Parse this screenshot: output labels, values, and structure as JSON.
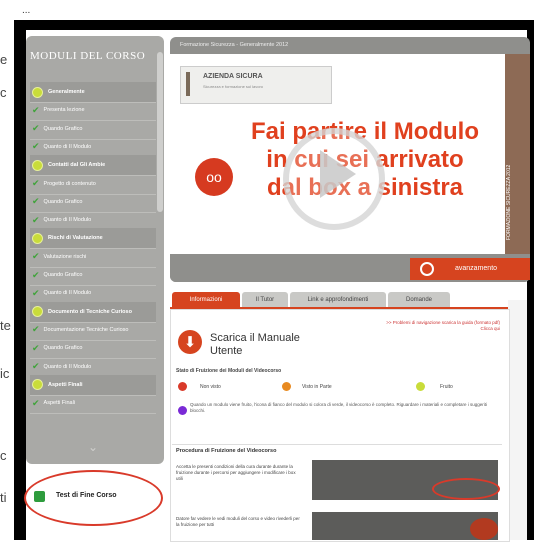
{
  "sidebar": {
    "title": "MODULI DEL CORSO",
    "rows": [
      {
        "type": "module",
        "label": "Generalmente"
      },
      {
        "type": "lesson",
        "label": "Presenta lezione"
      },
      {
        "type": "lesson",
        "label": "Quando Grafico"
      },
      {
        "type": "lesson",
        "label": "Quanto di Il Modulo"
      },
      {
        "type": "module",
        "label": "Contatti dal Gli Ambie"
      },
      {
        "type": "lesson",
        "label": "Progetto di contenuto"
      },
      {
        "type": "lesson",
        "label": "Quando Grafico"
      },
      {
        "type": "lesson",
        "label": "Quanto di Il Modulo"
      },
      {
        "type": "module",
        "label": "Rischi di Valutazione"
      },
      {
        "type": "lesson",
        "label": "Valutazione rischi"
      },
      {
        "type": "lesson",
        "label": "Quando Grafico"
      },
      {
        "type": "lesson",
        "label": "Quanto di Il Modulo"
      },
      {
        "type": "module",
        "label": "Documento di Tecniche Curioso"
      },
      {
        "type": "lesson",
        "label": "Documentazione Tecniche Curioso"
      },
      {
        "type": "lesson",
        "label": "Quando Grafico"
      },
      {
        "type": "lesson",
        "label": "Quanto di Il Modulo"
      },
      {
        "type": "module",
        "label": "Aspetti Finali"
      },
      {
        "type": "lesson",
        "label": "Aspetti Finali"
      }
    ],
    "test_label": "Test di Fine Corso"
  },
  "background": {
    "header_text": "...",
    "left_glyphs": [
      "e",
      "c",
      "te",
      "ic",
      "c",
      "ti"
    ]
  },
  "video": {
    "title": "Formazione Sicurezza - Generalmente 2012",
    "logo_title": "AZIENDA SICURA",
    "logo_sub": "Sicurezza e formazione sul lavoro",
    "headline_lines": [
      "Fai partire il Modulo",
      "in cui sei arrivato",
      "dal box a sinistra"
    ],
    "side_text": "FORMAZIONE SICUREZZA 2012",
    "badge_icon": "oo",
    "next_label": "avanzamento"
  },
  "tabs": [
    {
      "label": "Informazioni",
      "active": true
    },
    {
      "label": "Il Tutor",
      "active": false
    },
    {
      "label": "Link e approfondimenti",
      "active": false
    },
    {
      "label": "Domande",
      "active": false
    }
  ],
  "info": {
    "download_title": "Scarica il Manuale Utente",
    "download_link": ">> Problemi di navigazione scarica la guida (formato pdf) Clicca qui",
    "stato_heading": "Stato di Fruizione dei Moduli del Videocorso",
    "legend": [
      {
        "label": "Non visto",
        "color": "#d93a2a"
      },
      {
        "label": "Visto in Parte",
        "color": "#e88a20"
      },
      {
        "label": "Fruito",
        "color": "#c9dc3a"
      },
      {
        "label": "",
        "color": "#7a2ad6"
      }
    ],
    "stato_note": "Quando un modulo viene fruito, l'icona di fianco del modulo si colora di verde, il videocorso è completo. Riguardare i materiali e completare i suggeriti blocchi.",
    "section_2_heading": "Procedura di Fruizione del Videocorso",
    "para_1": "Accetta le presenti condizioni della cura durante durante la fruizione durante i percorsi per aggiungere i modificare i box utili",
    "para_2": "Datore far vedere le vedi moduli del corso e video rivederli per la fruizione per tutti"
  }
}
